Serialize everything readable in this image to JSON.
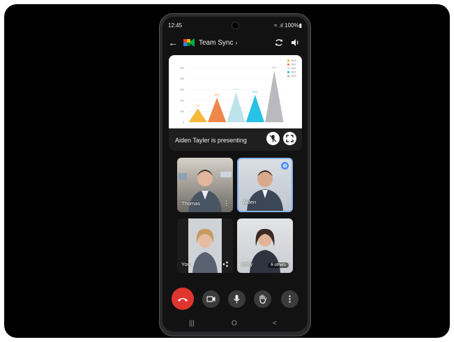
{
  "status": {
    "time": "12:45",
    "system": "≈ .ıl 100%▮"
  },
  "header": {
    "title": "Team Sync",
    "chevron": "›",
    "back_icon": "arrow-left"
  },
  "presentation": {
    "presenter_text": "Aiden Tayler is presenting",
    "chart_data": {
      "type": "area",
      "categories": [
        "2019",
        "2020",
        "2021",
        "2022",
        "2023"
      ],
      "values": [
        25,
        45,
        55,
        50,
        95
      ],
      "data_labels": [
        "25%",
        "45%",
        "55%",
        "50%",
        "95%"
      ],
      "y_ticks": [
        "500",
        "400",
        "300",
        "200",
        "100",
        "0"
      ],
      "legend": [
        "2019",
        "2020",
        "2021",
        "2022",
        "2023"
      ],
      "colors": [
        "#f6b93b",
        "#f0874a",
        "#bfe3ea",
        "#27c3e6",
        "#b9b9be"
      ],
      "legend_position": "top-right",
      "grid": true
    }
  },
  "participants": [
    {
      "name": "Thomas",
      "active": false
    },
    {
      "name": "Aiden",
      "active": true
    },
    {
      "name": "You",
      "active": false
    },
    {
      "name": "Kelly",
      "others": "6 others",
      "active": false
    }
  ],
  "colors": {
    "end_call": "#e1352f",
    "active_border": "#8ab4f8",
    "screen_bg": "#121212"
  },
  "controls": [
    "end-call",
    "camera",
    "microphone",
    "raise-hand",
    "more"
  ],
  "nav": {
    "recents": "|||",
    "home": "O",
    "back": "<"
  }
}
